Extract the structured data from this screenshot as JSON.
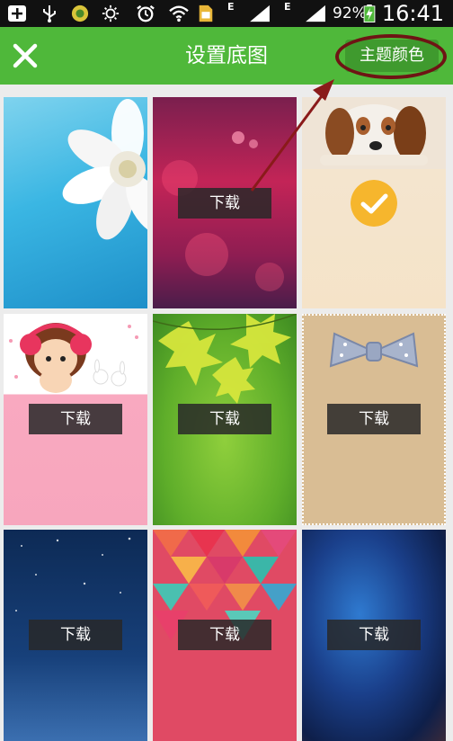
{
  "status_bar": {
    "battery": "92%",
    "time": "16:41",
    "network_letter_1": "E",
    "network_letter_2": "E",
    "icons": [
      "plus-icon",
      "usb-icon",
      "app-icon",
      "brightness-icon",
      "alarm-icon",
      "wifi-icon",
      "sim-card-icon",
      "signal-icon",
      "signal-icon",
      "battery-icon"
    ]
  },
  "header": {
    "title": "设置底图",
    "theme_button": "主题颜色",
    "close_icon": "close-icon"
  },
  "wallpapers": [
    {
      "name": "white-flower",
      "download": "",
      "selected": false
    },
    {
      "name": "pink-bokeh",
      "download": "下载",
      "selected": false
    },
    {
      "name": "puppy",
      "download": "",
      "selected": true
    },
    {
      "name": "cartoon-girl",
      "download": "下载",
      "selected": false
    },
    {
      "name": "green-leaves",
      "download": "下载",
      "selected": false
    },
    {
      "name": "bow",
      "download": "下载",
      "selected": false
    },
    {
      "name": "night-sky",
      "download": "下载",
      "selected": false
    },
    {
      "name": "geometric-triangles",
      "download": "下载",
      "selected": false
    },
    {
      "name": "blue-blur",
      "download": "下载",
      "selected": false
    }
  ],
  "colors": {
    "header": "#4fb83a",
    "annotation": "#6e1414",
    "check": "#f6b62d"
  }
}
